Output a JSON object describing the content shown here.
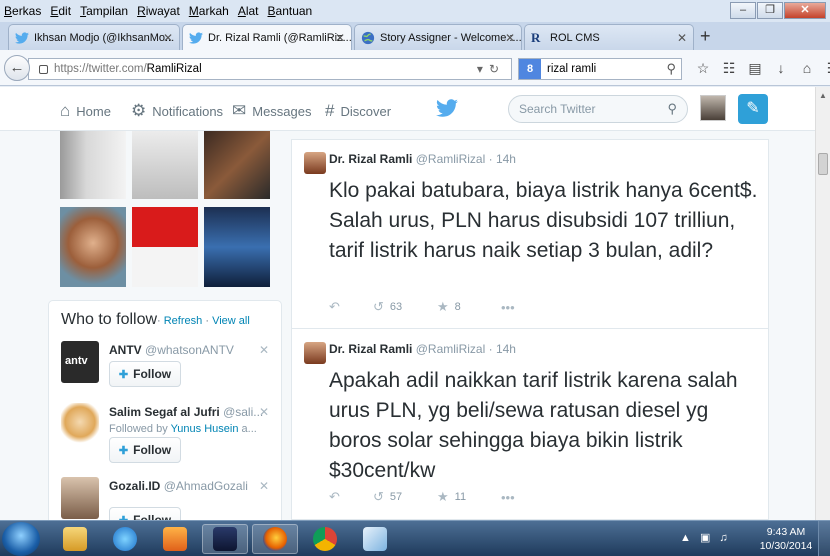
{
  "menubar": {
    "items": [
      {
        "label": "Berkas",
        "u": "B",
        "rest": "erkas"
      },
      {
        "label": "Edit",
        "u": "E",
        "rest": "dit"
      },
      {
        "label": "Tampilan",
        "u": "T",
        "rest": "ampilan"
      },
      {
        "label": "Riwayat",
        "u": "R",
        "rest": "iwayat"
      },
      {
        "label": "Markah",
        "u": "M",
        "rest": "arkah"
      },
      {
        "label": "Alat",
        "u": "A",
        "rest": "lat"
      },
      {
        "label": "Bantuan",
        "u": "B",
        "rest": "antuan"
      }
    ]
  },
  "tabs": [
    {
      "label": "Ikhsan Modjo (@IkhsanMo...",
      "icon": "twitter-bird-icon",
      "active": false
    },
    {
      "label": "Dr. Rizal Ramli (@RamliRiz...",
      "icon": "twitter-bird-icon",
      "active": true
    },
    {
      "label": "Story Assigner - Welcome :...",
      "icon": "globe-icon",
      "active": false
    },
    {
      "label": "ROL CMS",
      "icon": "rol-logo-icon",
      "active": false
    }
  ],
  "navbar": {
    "url_host": "https://twitter.com/",
    "url_path": "RamliRizal",
    "search_value": "rizal ramli"
  },
  "twitter": {
    "nav": {
      "home": "Home",
      "notifications": "Notifications",
      "messages": "Messages",
      "discover": "Discover"
    },
    "search_placeholder": "Search Twitter",
    "who_to_follow": {
      "title": "Who to follow",
      "sep": "·",
      "refresh": "Refresh",
      "view_all": "View all",
      "follow_label": "Follow",
      "accounts": [
        {
          "name": "ANTV",
          "handle": "@whatsonANTV"
        },
        {
          "name": "Salim Segaf al Jufri",
          "handle": "@sali...",
          "followed_by_prefix": "Followed by",
          "followed_by_name": "Yunus Husein",
          "followed_by_suffix": "a..."
        },
        {
          "name": "Gozali.ID",
          "handle": "@AhmadGozali"
        }
      ]
    },
    "tweets": [
      {
        "name": "Dr. Rizal Ramli",
        "handle": "@RamliRizal",
        "dot": "·",
        "time": "14h",
        "text": "Klo pakai batubara, biaya listrik hanya 6cent$. Salah urus, PLN harus disubsidi 107 trilliun, tarif listrik harus naik setiap 3 bulan, adil?",
        "retweets": "63",
        "favorites": "8"
      },
      {
        "name": "Dr. Rizal Ramli",
        "handle": "@RamliRizal",
        "dot": "·",
        "time": "14h",
        "text": "Apakah adil naikkan tarif listrik karena salah urus PLN, yg beli/sewa ratusan diesel yg boros solar sehingga biaya bikin listrik $30cent/kw",
        "retweets": "57",
        "favorites": "11"
      }
    ]
  },
  "taskbar": {
    "time": "9:43 AM",
    "date": "10/30/2014",
    "apps": [
      "file-explorer-icon",
      "internet-explorer-icon",
      "media-player-icon",
      "winamp-icon",
      "firefox-icon",
      "chrome-icon",
      "notepad-icon"
    ]
  },
  "colors": {
    "twitter_blue": "#55acee",
    "link": "#0084b4",
    "tweet_text": "#292f33"
  }
}
